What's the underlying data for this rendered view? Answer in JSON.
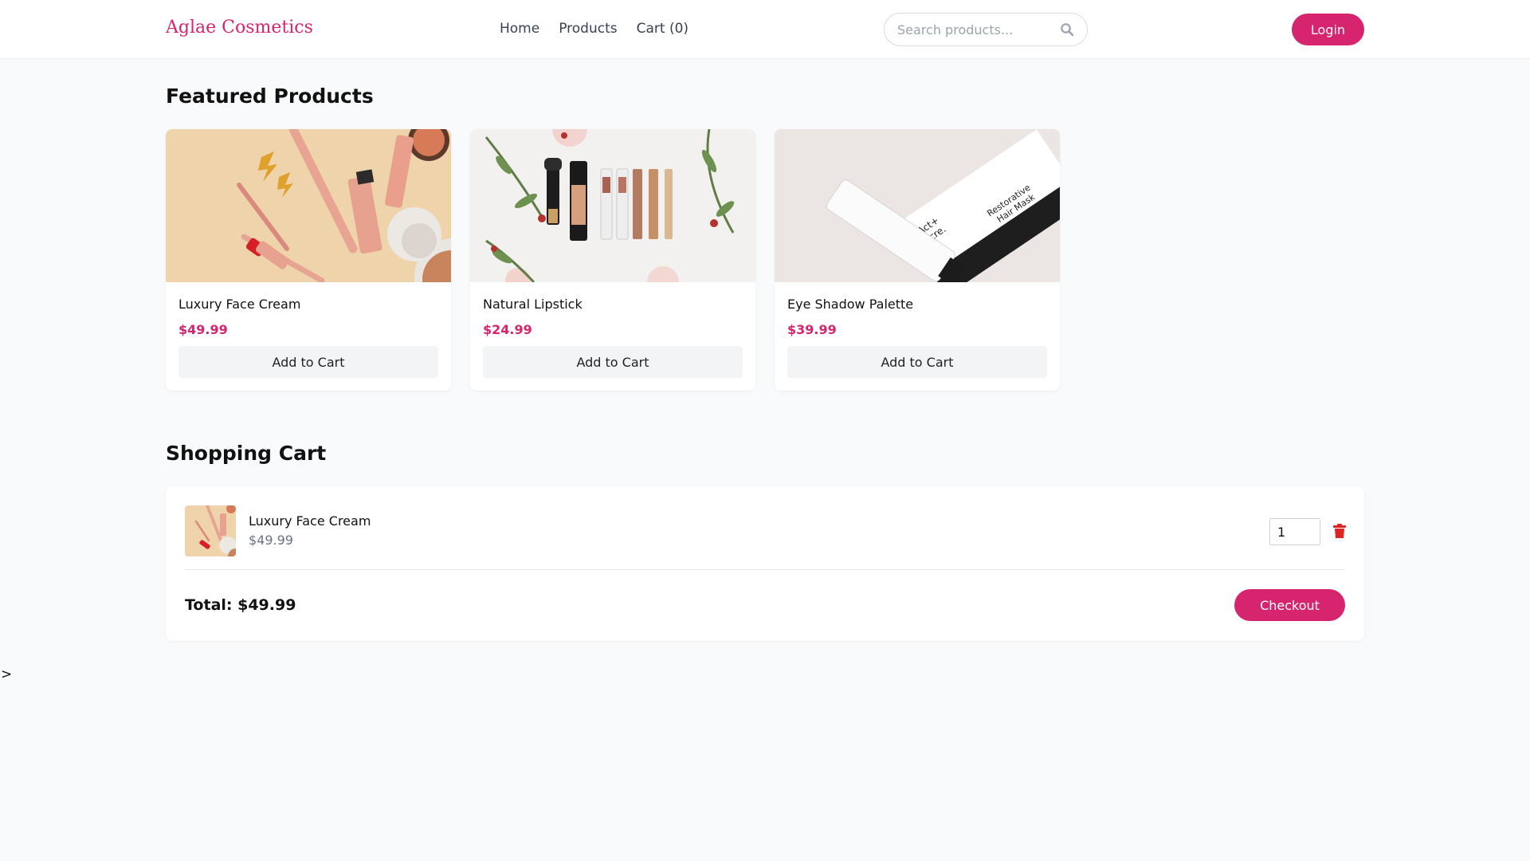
{
  "header": {
    "logo": "Aglae Cosmetics",
    "nav": [
      "Home",
      "Products",
      "Cart (0)"
    ],
    "search_placeholder": "Search products...",
    "login_label": "Login"
  },
  "featured": {
    "title": "Featured Products",
    "products": [
      {
        "name": "Luxury Face Cream",
        "price": "$49.99",
        "button": "Add to Cart"
      },
      {
        "name": "Natural Lipstick",
        "price": "$24.99",
        "button": "Add to Cart"
      },
      {
        "name": "Eye Shadow Palette",
        "price": "$39.99",
        "button": "Add to Cart"
      }
    ],
    "box_text": [
      "Act+",
      "Acre.",
      "Restorative",
      "Hair Mask"
    ]
  },
  "cart": {
    "title": "Shopping Cart",
    "items": [
      {
        "name": "Luxury Face Cream",
        "price": "$49.99",
        "quantity": "1"
      }
    ],
    "total": "Total: $49.99",
    "checkout_label": "Checkout"
  },
  "stray_text": ">",
  "colors": {
    "accent": "#d6246e",
    "background": "#f9fafb",
    "delete": "#dc2626"
  },
  "icons": [
    "search-icon",
    "trash-icon"
  ]
}
